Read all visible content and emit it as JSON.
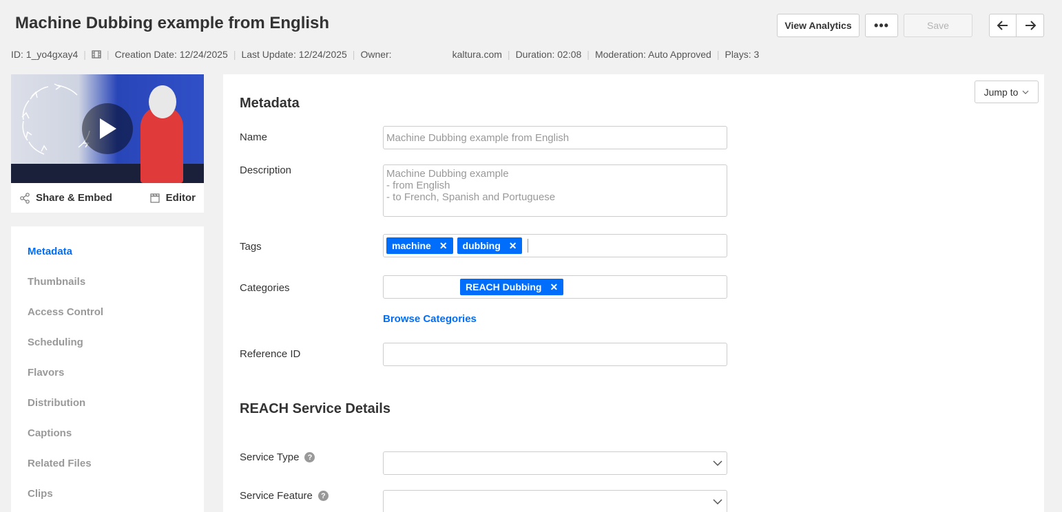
{
  "header": {
    "title": "Machine Dubbing example from English",
    "view_analytics_label": "View Analytics",
    "more_label": "•••",
    "save_label": "Save"
  },
  "meta": {
    "id": "ID: 1_yo4gxay4",
    "creation_date": "Creation Date: 12/24/2025",
    "last_update": "Last Update: 12/24/2025",
    "owner": "Owner:",
    "owner_domain": "kaltura.com",
    "duration": "Duration: 02:08",
    "moderation": "Moderation: Auto Approved",
    "plays": "Plays: 3"
  },
  "player": {
    "share_label": "Share & Embed",
    "editor_label": "Editor"
  },
  "sidebar": {
    "items": [
      {
        "label": "Metadata"
      },
      {
        "label": "Thumbnails"
      },
      {
        "label": "Access Control"
      },
      {
        "label": "Scheduling"
      },
      {
        "label": "Flavors"
      },
      {
        "label": "Distribution"
      },
      {
        "label": "Captions"
      },
      {
        "label": "Related Files"
      },
      {
        "label": "Clips"
      }
    ],
    "active": "Metadata"
  },
  "panel": {
    "jump_label": "Jump to",
    "metadata_heading": "Metadata",
    "name_label": "Name",
    "name_value": "Machine Dubbing example from English",
    "description_label": "Description",
    "description_value": "Machine Dubbing example\n- from English\n- to French, Spanish and Portuguese",
    "tags_label": "Tags",
    "tags": [
      "machine",
      "dubbing"
    ],
    "categories_label": "Categories",
    "categories": [
      "REACH Dubbing"
    ],
    "browse_categories_label": "Browse Categories",
    "reference_id_label": "Reference ID",
    "reference_id_value": "",
    "reach_heading": "REACH Service Details",
    "service_type_label": "Service Type",
    "service_feature_label": "Service Feature"
  },
  "colors": {
    "accent": "#006efa",
    "background": "#f1f1f1"
  }
}
